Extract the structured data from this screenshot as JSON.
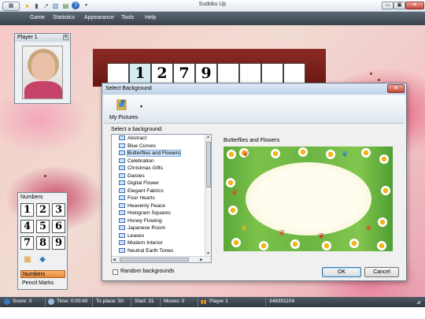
{
  "window": {
    "title": "Sudoku Up",
    "app_icon": "sudoku-app-icon",
    "quick_access": [
      "new-game-icon",
      "undo-icon",
      "hint-icon",
      "stats-icon",
      "help-icon",
      "customize-arrow-icon"
    ],
    "controls": [
      "restore-icon",
      "maximize-icon",
      "close-icon"
    ]
  },
  "menu": {
    "items": [
      "Game",
      "Statistics",
      "Appearance",
      "Tools",
      "Help"
    ]
  },
  "player": {
    "title": "Player 1",
    "close": "x"
  },
  "board": {
    "visible_digits": [
      "1",
      "2",
      "7",
      "9"
    ]
  },
  "numbers_panel": {
    "title": "Numbers",
    "keys": [
      "1",
      "2",
      "3",
      "4",
      "5",
      "6",
      "7",
      "8",
      "9"
    ],
    "tools": [
      "grid-icon",
      "eraser-icon"
    ],
    "modes": [
      "Numbers",
      "Pencil Marks"
    ],
    "active_mode": "Numbers"
  },
  "status": {
    "score": "Score: 0",
    "time": "Time: 0:00:40",
    "to_place": "To place: 50",
    "start": "Start: 31",
    "moves": "Moves: 0",
    "player": "Player 1",
    "game_id": "348391104"
  },
  "dialog": {
    "title": "Select Background",
    "close": "x",
    "toolbar_button": "My Pictures",
    "select_label": "Select a background:",
    "backgrounds": [
      "Abstract",
      "Blue Curves",
      "Butterflies and Flowers",
      "Celebration",
      "Christmas Gifts",
      "Daisies",
      "Digital Flower",
      "Elegant Fabrics",
      "Four Hearts",
      "Heavenly Peace",
      "Hologram Squares",
      "Honey Flowing",
      "Japanese Room",
      "Leaves",
      "Modern Interior",
      "Neutral Earth Tones"
    ],
    "selected": "Butterflies and Flowers",
    "preview_label": "Butterflies and Flowers",
    "random_label": "Random backgrounds",
    "random_checked": false,
    "ok": "OK",
    "cancel": "Cancel"
  },
  "colors": {
    "menubar": "#3f4851",
    "accent_orange": "#e88a3a",
    "board_frame": "#7a1e1a",
    "selection": "#cde3f8"
  }
}
